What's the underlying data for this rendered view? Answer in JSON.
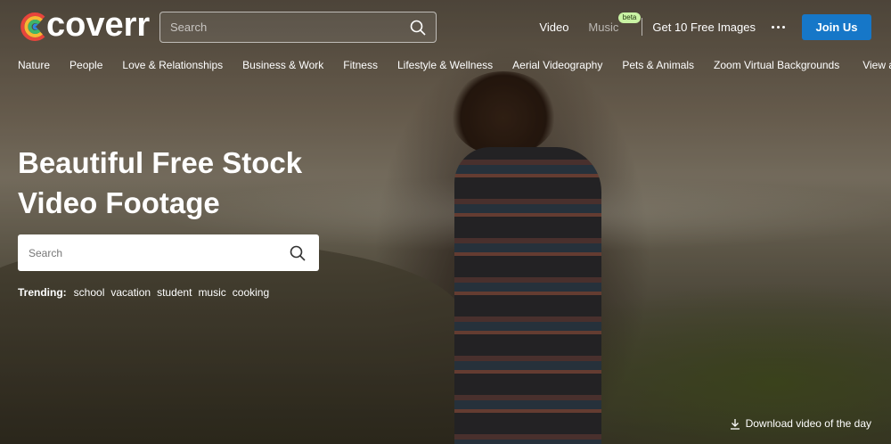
{
  "brand": {
    "name": "coverr",
    "logo_colors": [
      "#e8453c",
      "#f7b733",
      "#3fb56a",
      "#2e86de"
    ]
  },
  "header": {
    "search_placeholder": "Search",
    "nav": {
      "video": "Video",
      "music": "Music",
      "music_badge": "beta",
      "free_images": "Get 10 Free Images",
      "join": "Join Us"
    },
    "join_color": "#1677c8"
  },
  "categories": [
    "Nature",
    "People",
    "Love & Relationships",
    "Business & Work",
    "Fitness",
    "Lifestyle & Wellness",
    "Aerial Videography",
    "Pets & Animals",
    "Zoom Virtual Backgrounds"
  ],
  "view_all": "View all",
  "hero": {
    "title_line1": "Beautiful Free Stock",
    "title_line2": "Video Footage",
    "search_placeholder": "Search",
    "trending_label": "Trending:",
    "trending": [
      "school",
      "vacation",
      "student",
      "music",
      "cooking"
    ]
  },
  "download_label": "Download video of the day"
}
